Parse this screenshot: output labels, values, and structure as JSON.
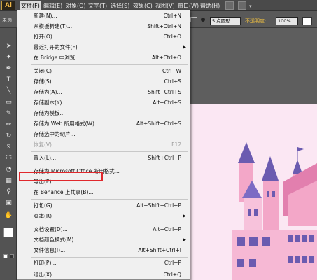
{
  "app_logo": "Ai",
  "menubar": {
    "items": [
      "文件(F)",
      "编辑(E)",
      "对象(O)",
      "文字(T)",
      "选择(S)",
      "效果(C)",
      "视图(V)",
      "窗口(W)",
      "帮助(H)"
    ],
    "active_item": "文件(F)"
  },
  "controlbar": {
    "left_text": "未选",
    "stroke_profile": "5 点圆形",
    "opacity_label": "不透明度:",
    "opacity_value": "100%"
  },
  "file_menu": {
    "items": [
      {
        "label": "新建(N)...",
        "shortcut": "Ctrl+N"
      },
      {
        "label": "从模板新建(T)...",
        "shortcut": "Shift+Ctrl+N"
      },
      {
        "label": "打开(O)...",
        "shortcut": "Ctrl+O"
      },
      {
        "label": "最近打开的文件(F)",
        "shortcut": "",
        "submenu": true
      },
      {
        "label": "在 Bridge 中浏览...",
        "shortcut": "Alt+Ctrl+O"
      },
      {
        "label": "关闭(C)",
        "shortcut": "Ctrl+W"
      },
      {
        "label": "存储(S)",
        "shortcut": "Ctrl+S"
      },
      {
        "label": "存储为(A)...",
        "shortcut": "Shift+Ctrl+S"
      },
      {
        "label": "存储副本(Y)...",
        "shortcut": "Alt+Ctrl+S"
      },
      {
        "label": "存储为模板...",
        "shortcut": ""
      },
      {
        "label": "存储为 Web 所用格式(W)...",
        "shortcut": "Alt+Shift+Ctrl+S"
      },
      {
        "label": "存储选中的切片...",
        "shortcut": ""
      },
      {
        "label": "恢复(V)",
        "shortcut": "F12",
        "disabled": true
      },
      {
        "label": "置入(L)...",
        "shortcut": "Shift+Ctrl+P"
      },
      {
        "label": "存储为 Microsoft Office 所用格式...",
        "shortcut": ""
      },
      {
        "label": "导出(E)...",
        "shortcut": ""
      },
      {
        "label": "在 Behance 上共享(B)...",
        "shortcut": ""
      },
      {
        "label": "打包(G)...",
        "shortcut": "Alt+Shift+Ctrl+P"
      },
      {
        "label": "脚本(R)",
        "shortcut": "",
        "submenu": true
      },
      {
        "label": "文档设置(D)...",
        "shortcut": "Alt+Ctrl+P"
      },
      {
        "label": "文档颜色模式(M)",
        "shortcut": "",
        "submenu": true
      },
      {
        "label": "文件信息(I)...",
        "shortcut": "Alt+Shift+Ctrl+I"
      },
      {
        "label": "打印(P)...",
        "shortcut": "Ctrl+P"
      },
      {
        "label": "退出(X)",
        "shortcut": "Ctrl+Q"
      }
    ],
    "highlighted_item": "导出(E)..."
  },
  "colors": {
    "highlight_border": "#e0282c",
    "canvas_bg": "#fbe7f3",
    "castle_purple": "#6b5bb0",
    "castle_pink": "#f3a7c8"
  }
}
